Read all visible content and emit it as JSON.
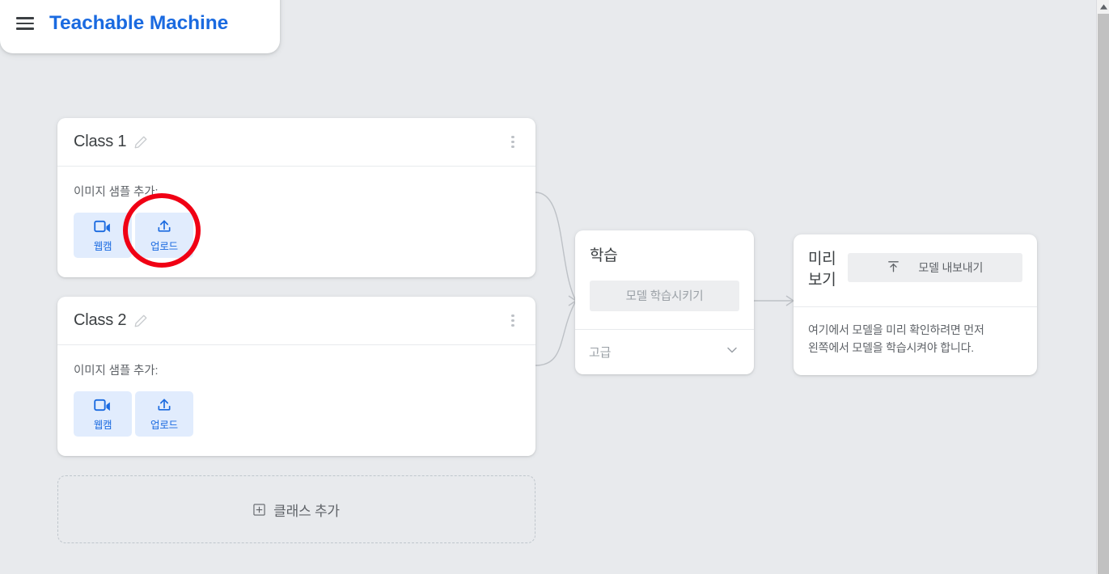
{
  "header": {
    "menu_icon": "hamburger-icon",
    "title": "Teachable Machine",
    "brand_color": "#1a6ae0"
  },
  "classes": [
    {
      "name": "Class 1",
      "edit_icon": "pencil-icon",
      "menu_icon": "kebab-menu-icon",
      "sample_label": "이미지 샘플 추가:",
      "sources": [
        {
          "icon": "webcam-icon",
          "label": "웹캠"
        },
        {
          "icon": "upload-icon",
          "label": "업로드"
        }
      ]
    },
    {
      "name": "Class 2",
      "edit_icon": "pencil-icon",
      "menu_icon": "kebab-menu-icon",
      "sample_label": "이미지 샘플 추가:",
      "sources": [
        {
          "icon": "webcam-icon",
          "label": "웹캠"
        },
        {
          "icon": "upload-icon",
          "label": "업로드"
        }
      ]
    }
  ],
  "add_class": {
    "icon": "plus-box-icon",
    "label": "클래스 추가"
  },
  "training": {
    "heading": "학습",
    "train_button_label": "모델 학습시키기",
    "advanced_label": "고급",
    "advanced_chevron_icon": "chevron-down-icon"
  },
  "preview": {
    "heading": "미리\n보기",
    "export_icon": "export-upload-icon",
    "export_button_label": "모델 내보내기",
    "hint": "여기에서 모델을 미리 확인하려면 먼저\n왼쪽에서 모델을 학습시켜야 합니다."
  },
  "annotation": {
    "shape": "red-ellipse-highlight",
    "target": "업로드",
    "color": "#f00014"
  },
  "scrollbar": {
    "up_arrow_icon": "scroll-up-arrow-icon",
    "thumb": "scroll-thumb"
  },
  "theme": {
    "background": "#e8eaed",
    "card": "#ffffff",
    "accent": "#1a6ae0",
    "muted_text": "#5f6368",
    "disabled_text": "#9aa0a6"
  }
}
